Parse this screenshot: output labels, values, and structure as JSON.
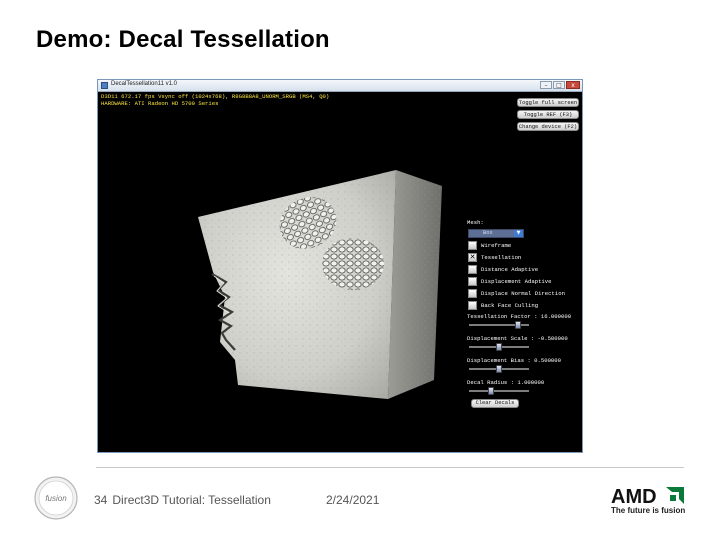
{
  "slide": {
    "title": "Demo: Decal Tessellation",
    "page_number": "34",
    "footer_text": "Direct3D Tutorial: Tessellation",
    "date": "2/24/2021",
    "amd_logo_text": "AMD",
    "amd_tagline": "The future is fusion",
    "fusion_logo_text": "fusion"
  },
  "window": {
    "title": "DecalTessellation11 v1.0",
    "buttons": {
      "minimize": "–",
      "maximize": "□",
      "close": "x"
    }
  },
  "stats": {
    "line1": "D3D11 672.17 fps Vsync off (1024x768), R8G8B8A8_UNORM_SRGB (MS4, Q0)",
    "line2": "HARDWARE: ATI Radeon HD 5700 Series"
  },
  "top_buttons": {
    "fullscreen": "Toggle full screen",
    "ref": "Toggle REF (F3)",
    "device": "Change device (F2)"
  },
  "panel": {
    "mesh_label": "Mesh:",
    "mesh_value": "Box",
    "dropdown_icon": "chevron-down-icon",
    "checkboxes": [
      {
        "label": "Wireframe",
        "checked": false
      },
      {
        "label": "Tessellation",
        "checked": true
      },
      {
        "label": "Distance Adaptive",
        "checked": false
      },
      {
        "label": "Displacement Adaptive",
        "checked": false
      },
      {
        "label": "Displace Normal Direction",
        "checked": false
      },
      {
        "label": "Back Face Culling",
        "checked": false
      }
    ],
    "check_mark": "✕",
    "sliders": [
      {
        "label": "Tessellation Factor : 16.000000",
        "level": 0.85
      },
      {
        "label": "Displacement Scale : -0.500000",
        "level": 0.5
      },
      {
        "label": "Displacement Bias : 0.500000",
        "level": 0.5
      },
      {
        "label": "Decal Radius : 1.000000",
        "level": 0.35
      }
    ],
    "clear_button": "Clear Decals"
  }
}
